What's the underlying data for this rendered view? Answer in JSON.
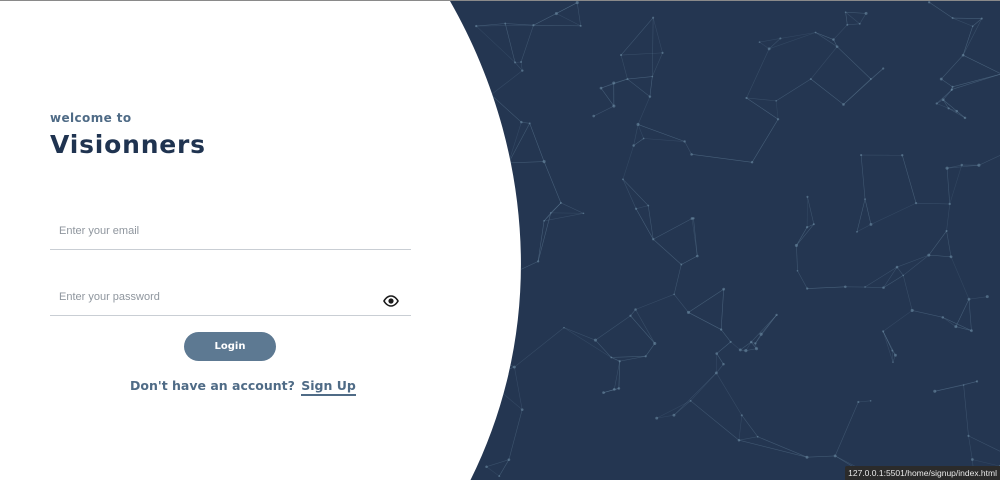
{
  "login": {
    "welcome_text": "welcome to",
    "brand_name": "Visionners",
    "email_placeholder": "Enter your email",
    "password_placeholder": "Enter your password",
    "login_button": "Login",
    "signup_prompt": "Don't have an account?",
    "signup_link": "Sign Up"
  },
  "status_bar": {
    "url": "127.0.0.1:5501/home/signup/index.html"
  },
  "colors": {
    "hero_background": "#243651",
    "network_lines": "#6f8fa8",
    "accent": "#4f6b86",
    "button": "#5d7992"
  },
  "icons": {
    "password_toggle": "eye-icon"
  }
}
